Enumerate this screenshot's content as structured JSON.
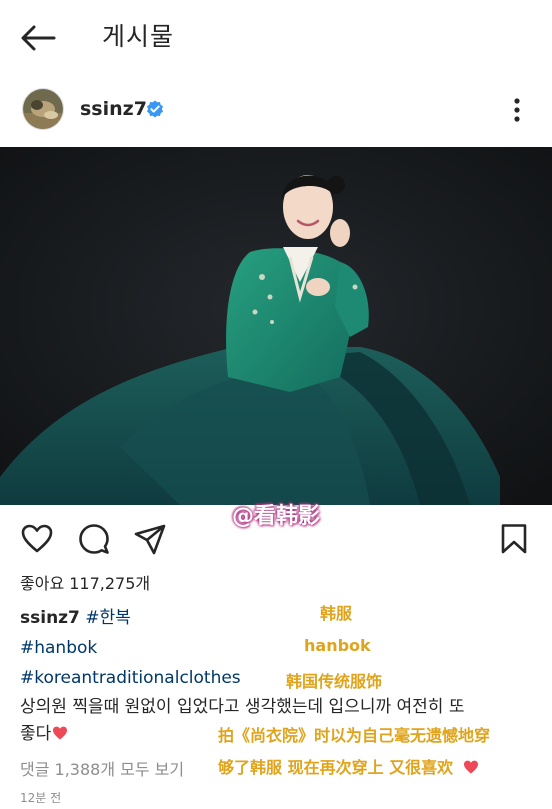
{
  "header": {
    "title": "게시물"
  },
  "author": {
    "username": "ssinz7"
  },
  "watermark": "@看韩影",
  "likes": {
    "text": "좋아요 117,275개"
  },
  "caption": {
    "username": "ssinz7",
    "hashtags": [
      "#한복",
      "#hanbok",
      "#koreantraditionalclothes"
    ],
    "body_line1": "상의원 찍을때 원없이 입었다고 생각했는데 입으니까 여전히 또",
    "body_line2": "좋다"
  },
  "comments_link": "댓글 1,388개 모두 보기",
  "timestamp": "12분 전",
  "annotations": {
    "line1": "韩服",
    "line2": "hanbok",
    "line3": "韩国传统服饰",
    "line4": "拍《尚衣院》时以为自己毫无遗憾地穿",
    "line5": "够了韩服 现在再次穿上 又很喜欢"
  },
  "colors": {
    "hashtag": "#00376b",
    "verified": "#3897f0",
    "annotation": "#e0a41c",
    "heart": "#ed4956",
    "photo_bg": "#16181b",
    "hanbok_green": "#1f8a73"
  },
  "icons": [
    "back-arrow-icon",
    "verified-badge-icon",
    "more-options-icon",
    "heart-icon",
    "comment-icon",
    "share-icon",
    "bookmark-icon",
    "red-heart-emoji-icon"
  ]
}
